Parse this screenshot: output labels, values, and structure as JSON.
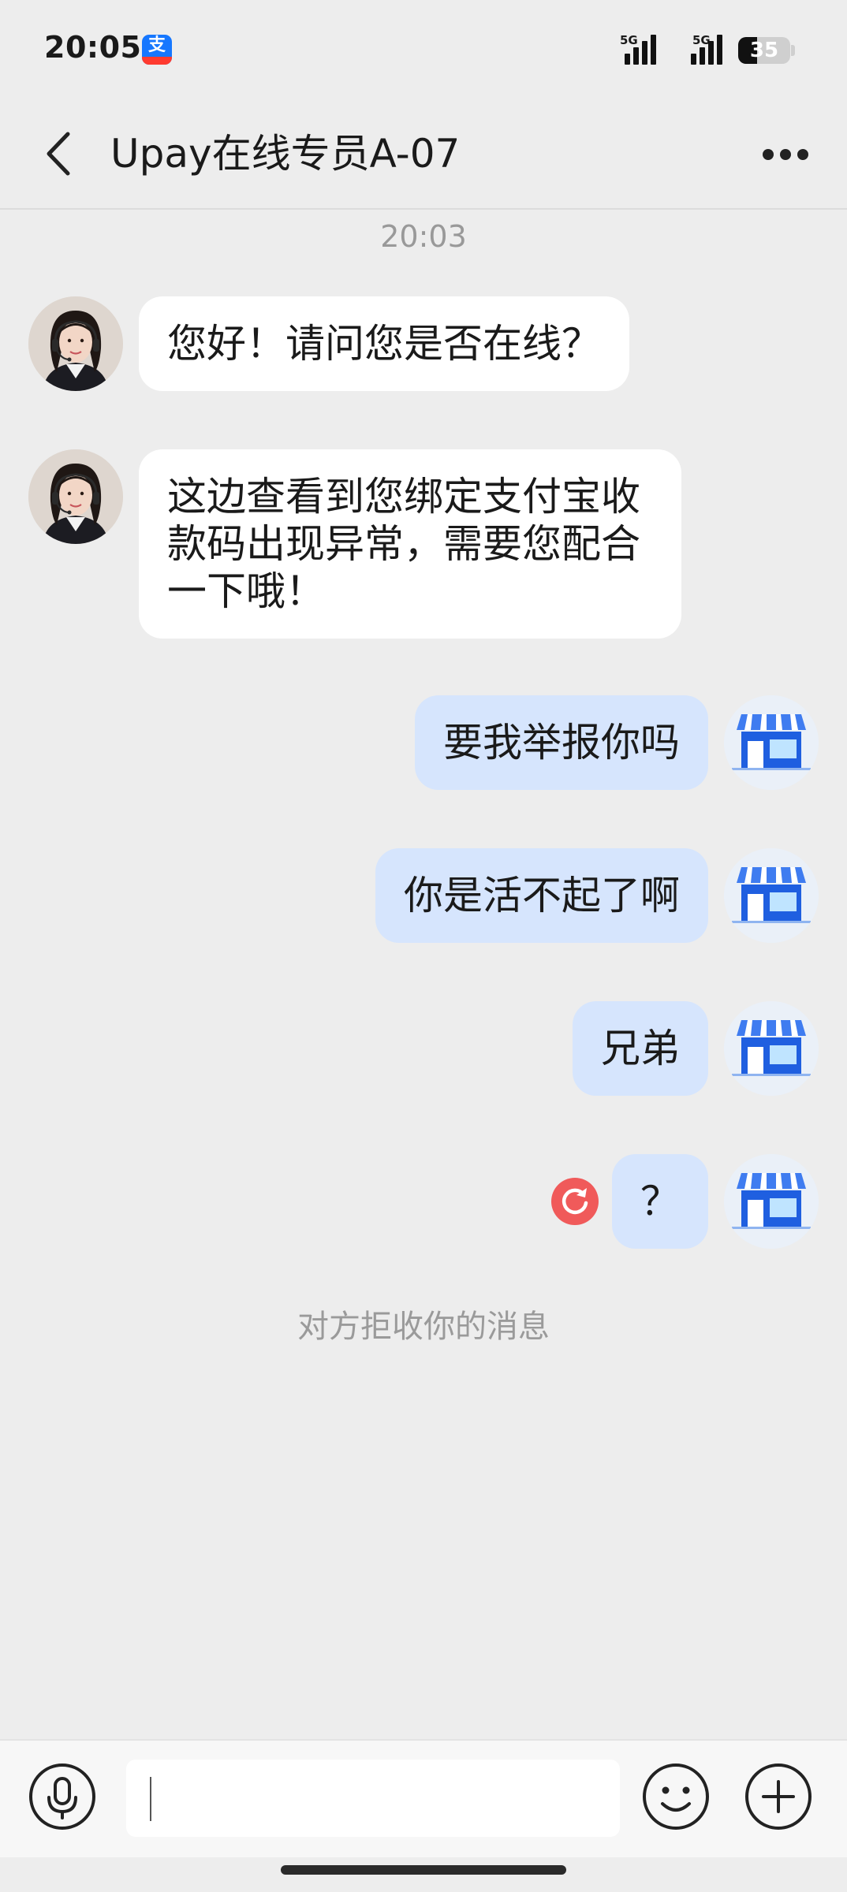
{
  "status_bar": {
    "time": "20:05",
    "app_icon": "alipay-icon",
    "app_icon_glyph": "支",
    "network_1": "5G",
    "network_2": "5G",
    "battery_level": "35"
  },
  "header": {
    "back_icon": "chevron-left-icon",
    "title": "Upay在线专员A-07",
    "more_icon": "more-dots-icon"
  },
  "chat": {
    "timestamp": "20:03",
    "messages": [
      {
        "sender": "agent",
        "lines": [
          "您好！请问您是否在线？"
        ]
      },
      {
        "sender": "agent",
        "lines": [
          "这边查看到您绑定支付宝收",
          "款码出现异常，需要您配合",
          "一下哦！"
        ]
      },
      {
        "sender": "me",
        "lines": [
          "要我举报你吗"
        ]
      },
      {
        "sender": "me",
        "lines": [
          "你是活不起了啊"
        ]
      },
      {
        "sender": "me",
        "lines": [
          "兄弟"
        ]
      },
      {
        "sender": "me",
        "lines": [
          "？"
        ],
        "status": "failed-resend-icon"
      }
    ],
    "system_note": "对方拒收你的消息"
  },
  "input_bar": {
    "voice_icon": "microphone-icon",
    "input_value": "",
    "emoji_icon": "smiley-icon",
    "plus_icon": "plus-icon"
  },
  "colors": {
    "page_background": "#ededed",
    "incoming_bubble": "#ffffff",
    "outgoing_bubble": "#d6e5fd",
    "failed_icon": "#f05a5a",
    "brand_blue": "#1677ff"
  }
}
